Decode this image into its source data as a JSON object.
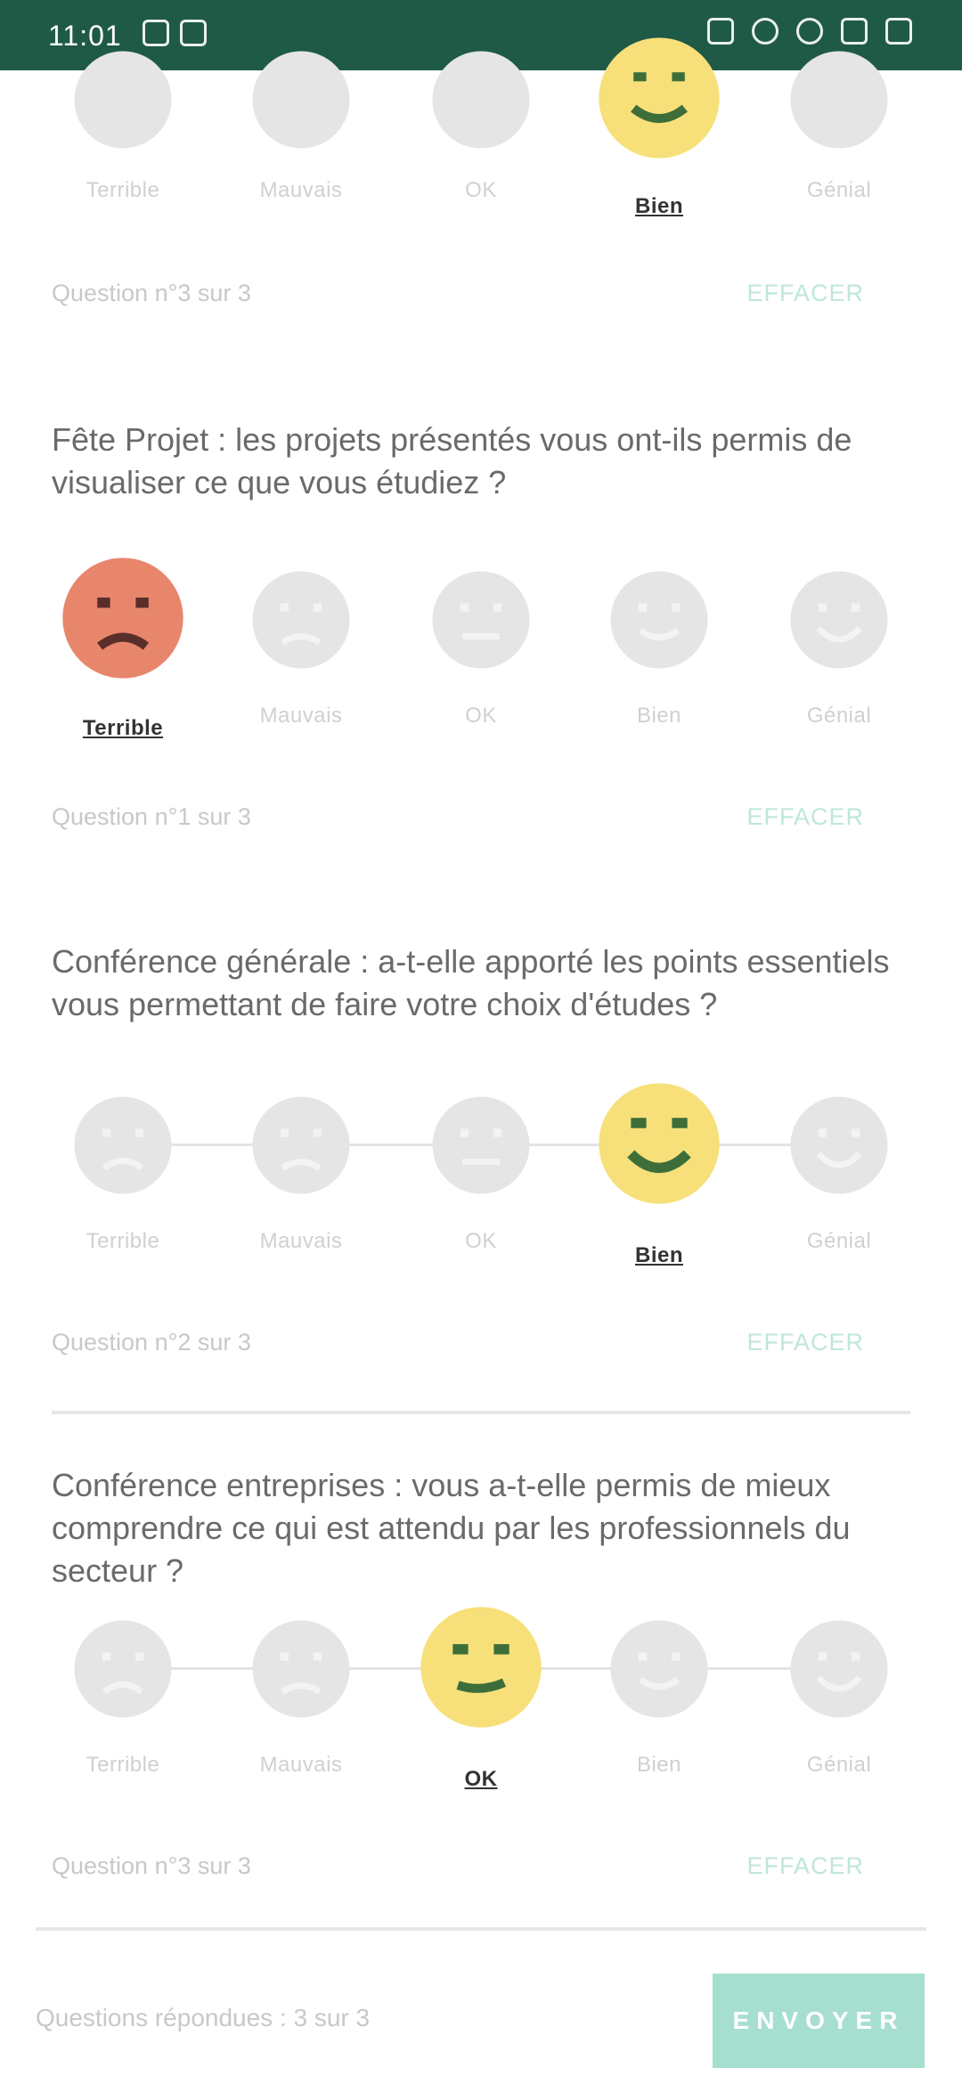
{
  "status_bar": {
    "time": "11:01"
  },
  "options": [
    "Terrible",
    "Mauvais",
    "OK",
    "Bien",
    "Génial"
  ],
  "questions": [
    {
      "text": "",
      "selected": 3,
      "meta_left": "Question n°3 sur 3",
      "meta_right": "EFFACER"
    },
    {
      "text": "Fête Projet : les projets présentés vous ont-ils permis de visualiser ce que vous étudiez ?",
      "selected": 0,
      "meta_left": "Question n°1 sur 3",
      "meta_right": "EFFACER"
    },
    {
      "text": "Conférence générale : a-t-elle apporté les points essentiels vous permettant de faire votre choix d'études ?",
      "selected": 3,
      "meta_left": "Question n°2 sur 3",
      "meta_right": "EFFACER"
    },
    {
      "text": "Conférence entreprises : vous a-t-elle permis de mieux comprendre ce qui est attendu par les professionnels du secteur ?",
      "selected": 2,
      "meta_left": "Question n°3 sur 3",
      "meta_right": "EFFACER"
    }
  ],
  "footer": {
    "text": "Questions répondues : 3 sur 3",
    "button_label": "ENVOYER"
  },
  "colors": {
    "status_bar": "#1f5a47",
    "face_terrible": "#e8866c",
    "face_positive": "#f7e07a",
    "face_inactive": "#e5e5e5",
    "accent": "#a6dfcf"
  }
}
